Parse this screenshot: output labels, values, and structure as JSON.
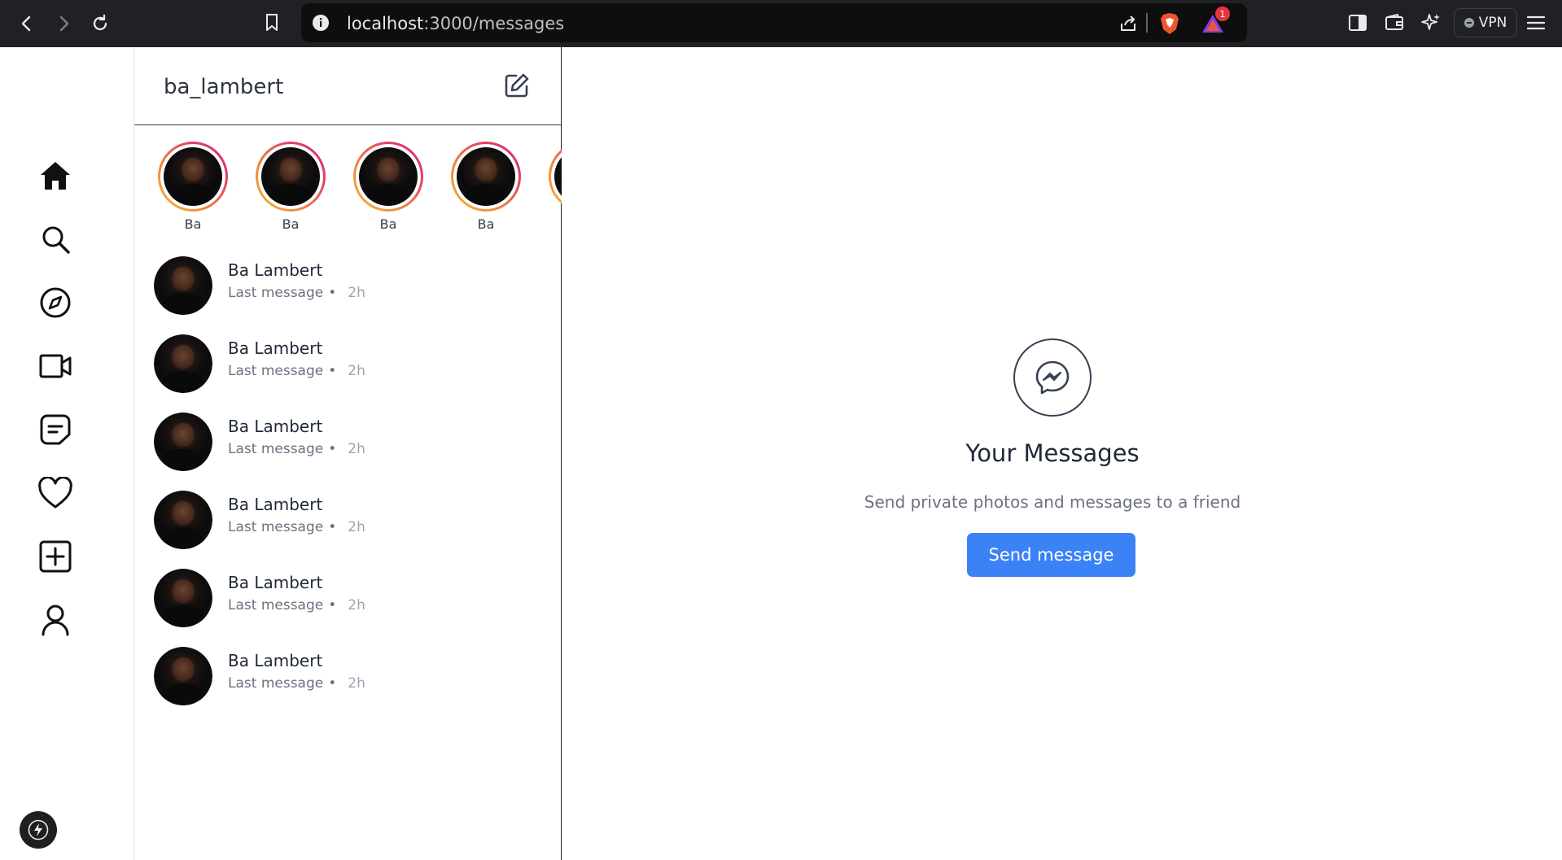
{
  "browser": {
    "url_host": "localhost",
    "url_path": ":3000/messages",
    "vpn_label": "VPN",
    "notification_count": "1"
  },
  "conversations_panel": {
    "username": "ba_lambert",
    "stories": [
      {
        "name": "Ba"
      },
      {
        "name": "Ba"
      },
      {
        "name": "Ba"
      },
      {
        "name": "Ba"
      }
    ],
    "items": [
      {
        "name": "Ba Lambert",
        "last_message": "Last message",
        "separator": "•",
        "time": "2h"
      },
      {
        "name": "Ba Lambert",
        "last_message": "Last message",
        "separator": "•",
        "time": "2h"
      },
      {
        "name": "Ba Lambert",
        "last_message": "Last message",
        "separator": "•",
        "time": "2h"
      },
      {
        "name": "Ba Lambert",
        "last_message": "Last message",
        "separator": "•",
        "time": "2h"
      },
      {
        "name": "Ba Lambert",
        "last_message": "Last message",
        "separator": "•",
        "time": "2h"
      },
      {
        "name": "Ba Lambert",
        "last_message": "Last message",
        "separator": "•",
        "time": "2h"
      }
    ]
  },
  "sidebar": {
    "items": [
      {
        "icon": "home-icon"
      },
      {
        "icon": "search-icon"
      },
      {
        "icon": "compass-icon"
      },
      {
        "icon": "video-icon"
      },
      {
        "icon": "messages-icon"
      },
      {
        "icon": "heart-icon"
      },
      {
        "icon": "create-icon"
      },
      {
        "icon": "profile-icon"
      }
    ]
  },
  "empty_state": {
    "title": "Your Messages",
    "subtitle": "Send private photos and messages to a friend",
    "button_label": "Send message"
  },
  "colors": {
    "accent": "#3b82f6",
    "chrome": "#202124"
  }
}
